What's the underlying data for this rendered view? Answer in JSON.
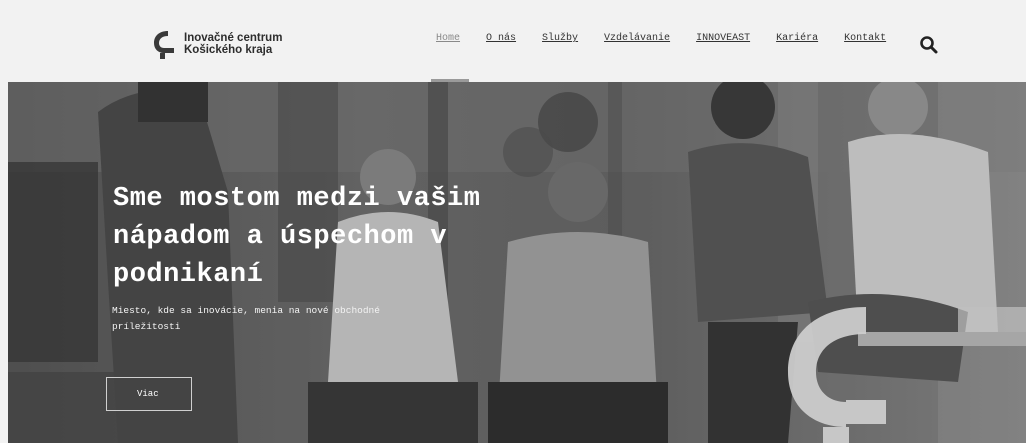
{
  "brand": {
    "name_line1": "Inovačné centrum",
    "name_line2": "Košického kraja"
  },
  "nav": {
    "items": [
      {
        "label": "Home",
        "active": true
      },
      {
        "label": "O nás",
        "active": false
      },
      {
        "label": "Služby",
        "active": false
      },
      {
        "label": "Vzdelávanie",
        "active": false
      },
      {
        "label": "INNOVEAST",
        "active": false
      },
      {
        "label": "Kariéra",
        "active": false
      },
      {
        "label": "Kontakt",
        "active": false
      }
    ],
    "search_icon": "search-icon"
  },
  "hero": {
    "title": "Sme mostom medzi vašim nápadom a úspechom v podnikaní",
    "subtitle": "Miesto, kde sa inovácie, menia na nové obchodné príležitosti",
    "button_label": "Viac"
  },
  "colors": {
    "header_bg": "#f2f2f2",
    "text_dark": "#2d2d2d",
    "hero_overlay": "#6e6e6e",
    "white": "#ffffff"
  }
}
